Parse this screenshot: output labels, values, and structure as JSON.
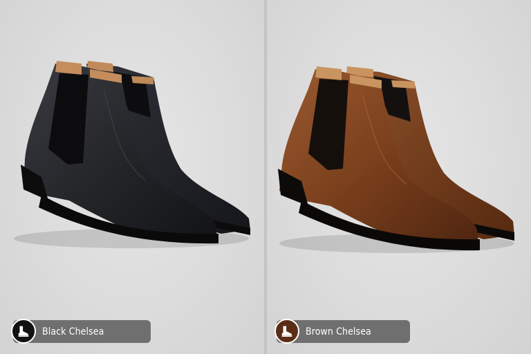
{
  "panels": [
    {
      "label": "Black Chelsea",
      "icon": "boot-icon",
      "badge_color": "#6f6f6f",
      "icon_bg": "#111111",
      "boot_color": "#1c1d20"
    },
    {
      "label": "Brown Chelsea",
      "icon": "boot-icon",
      "badge_color": "#6f6f6f",
      "icon_bg": "#5a2d16",
      "boot_color": "#7a3f1c"
    }
  ]
}
